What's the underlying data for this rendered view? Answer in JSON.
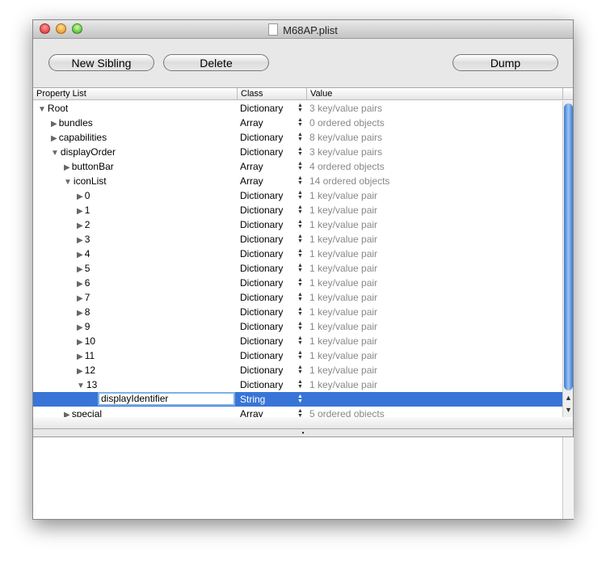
{
  "window": {
    "title": "M68AP.plist"
  },
  "toolbar": {
    "new_sibling": "New Sibling",
    "delete": "Delete",
    "dump": "Dump"
  },
  "table": {
    "headers": [
      "Property List",
      "Class",
      "Value"
    ],
    "rows": [
      {
        "name": "Root",
        "depth": 0,
        "tri": "down",
        "cls": "Dictionary",
        "val": "3 key/value pairs"
      },
      {
        "name": "bundles",
        "depth": 1,
        "tri": "right",
        "cls": "Array",
        "val": "0 ordered objects"
      },
      {
        "name": "capabilities",
        "depth": 1,
        "tri": "right",
        "cls": "Dictionary",
        "val": "8 key/value pairs"
      },
      {
        "name": "displayOrder",
        "depth": 1,
        "tri": "down",
        "cls": "Dictionary",
        "val": "3 key/value pairs"
      },
      {
        "name": "buttonBar",
        "depth": 2,
        "tri": "right",
        "cls": "Array",
        "val": "4 ordered objects"
      },
      {
        "name": "iconList",
        "depth": 2,
        "tri": "down",
        "cls": "Array",
        "val": "14 ordered objects"
      },
      {
        "name": "0",
        "depth": 3,
        "tri": "right",
        "cls": "Dictionary",
        "val": "1 key/value pair"
      },
      {
        "name": "1",
        "depth": 3,
        "tri": "right",
        "cls": "Dictionary",
        "val": "1 key/value pair"
      },
      {
        "name": "2",
        "depth": 3,
        "tri": "right",
        "cls": "Dictionary",
        "val": "1 key/value pair"
      },
      {
        "name": "3",
        "depth": 3,
        "tri": "right",
        "cls": "Dictionary",
        "val": "1 key/value pair"
      },
      {
        "name": "4",
        "depth": 3,
        "tri": "right",
        "cls": "Dictionary",
        "val": "1 key/value pair"
      },
      {
        "name": "5",
        "depth": 3,
        "tri": "right",
        "cls": "Dictionary",
        "val": "1 key/value pair"
      },
      {
        "name": "6",
        "depth": 3,
        "tri": "right",
        "cls": "Dictionary",
        "val": "1 key/value pair"
      },
      {
        "name": "7",
        "depth": 3,
        "tri": "right",
        "cls": "Dictionary",
        "val": "1 key/value pair"
      },
      {
        "name": "8",
        "depth": 3,
        "tri": "right",
        "cls": "Dictionary",
        "val": "1 key/value pair"
      },
      {
        "name": "9",
        "depth": 3,
        "tri": "right",
        "cls": "Dictionary",
        "val": "1 key/value pair"
      },
      {
        "name": "10",
        "depth": 3,
        "tri": "right",
        "cls": "Dictionary",
        "val": "1 key/value pair"
      },
      {
        "name": "11",
        "depth": 3,
        "tri": "right",
        "cls": "Dictionary",
        "val": "1 key/value pair"
      },
      {
        "name": "12",
        "depth": 3,
        "tri": "right",
        "cls": "Dictionary",
        "val": "1 key/value pair"
      },
      {
        "name": "13",
        "depth": 3,
        "tri": "down",
        "cls": "Dictionary",
        "val": "1 key/value pair"
      },
      {
        "name": "displayIdentifier",
        "depth": 4,
        "tri": "none",
        "cls": "String",
        "val": "",
        "selected": true,
        "editing": true
      },
      {
        "name": "special",
        "depth": 2,
        "tri": "right",
        "cls": "Array",
        "val": "5 ordered objects"
      }
    ]
  }
}
